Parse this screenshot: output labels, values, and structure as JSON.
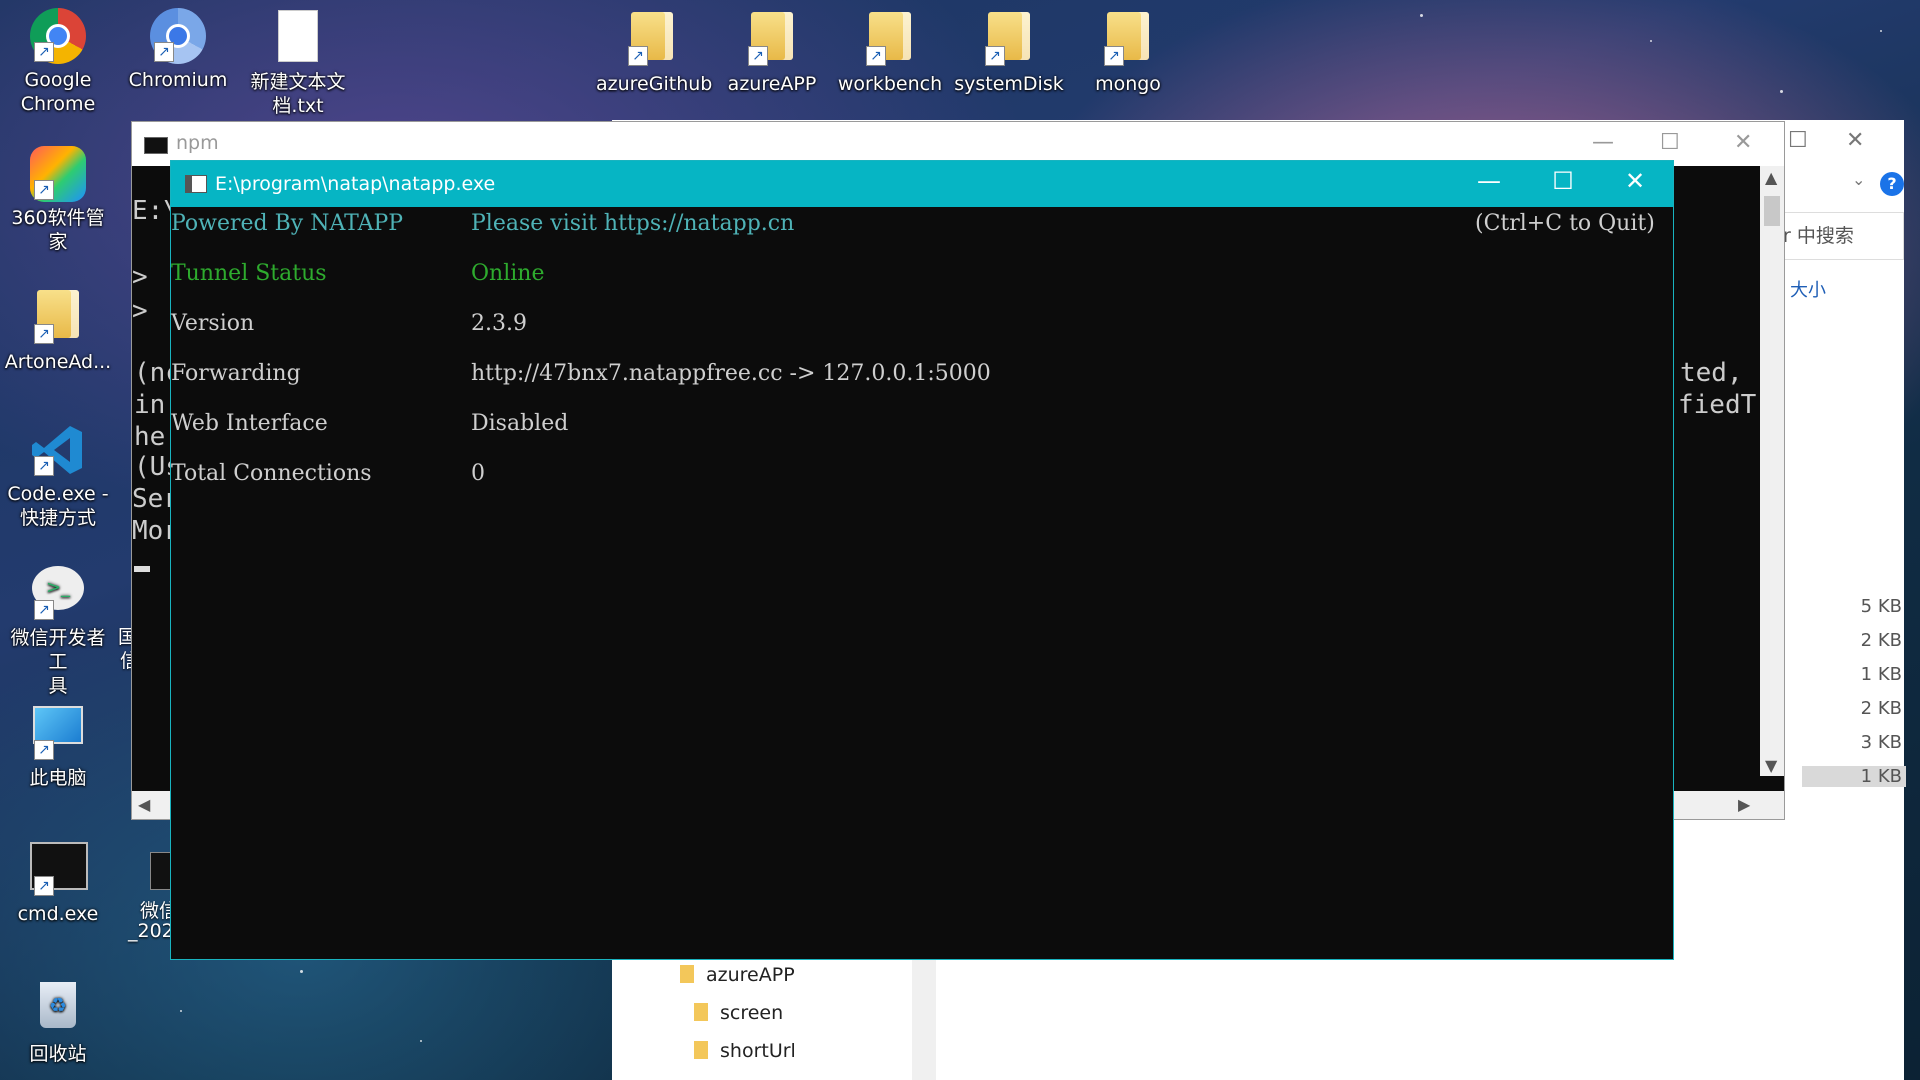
{
  "desktop": {
    "icons_left": [
      {
        "label": "Google\nChrome",
        "icon": "chrome-icon"
      },
      {
        "label": "360软件管家",
        "icon": "360-software-manager-icon"
      },
      {
        "label": "ArtoneAd...",
        "icon": "folder-icon"
      },
      {
        "label": "Code.exe -\n快捷方式",
        "icon": "vscode-icon"
      },
      {
        "label": "微信开发者工\n具",
        "icon": "wechat-devtools-icon"
      },
      {
        "label": "此电脑",
        "icon": "this-pc-icon"
      },
      {
        "label": "cmd.exe",
        "icon": "cmd-icon"
      },
      {
        "label": "回收站",
        "icon": "recycle-bin-icon"
      }
    ],
    "icons_top": [
      {
        "label": "Chromium",
        "icon": "chromium-icon"
      },
      {
        "label": "新建文本文\n档.txt",
        "icon": "text-file-icon"
      },
      {
        "label": "azureGithub",
        "icon": "folder-icon"
      },
      {
        "label": "azureAPP",
        "icon": "folder-icon"
      },
      {
        "label": "workbench",
        "icon": "folder-icon"
      },
      {
        "label": "systemDisk",
        "icon": "folder-icon"
      },
      {
        "label": "mongo",
        "icon": "folder-icon"
      }
    ],
    "partial_labels": {
      "col2_a": "国",
      "col2_b": "信",
      "wechat_partial_1": "微信",
      "wechat_partial_2": "_202"
    }
  },
  "explorer": {
    "search_placeholder": "r 中搜索",
    "size_header": "大小",
    "sizes": [
      "5 KB",
      "2 KB",
      "1 KB",
      "2 KB",
      "3 KB",
      "1 KB"
    ],
    "tree": [
      "azureAPP",
      "screen",
      "shortUrl"
    ],
    "help": "?"
  },
  "npm_window": {
    "title": "npm",
    "lines_left": [
      "E:\\",
      ">",
      ">",
      "(nc",
      "in",
      "he",
      "(Us",
      "Ser",
      "Mor"
    ],
    "lines_right": [
      "ted,",
      "fiedT"
    ]
  },
  "natapp_window": {
    "title": "E:\\program\\natap\\natapp.exe",
    "header": {
      "left": "Powered By NATAPP",
      "middle": "Please visit https://natapp.cn",
      "right": "(Ctrl+C to Quit)"
    },
    "rows": [
      {
        "label": "Tunnel Status",
        "value": "Online"
      },
      {
        "label": "Version",
        "value": "2.3.9"
      },
      {
        "label": "Forwarding",
        "value": "http://47bnx7.natappfree.cc -> 127.0.0.1:5000"
      },
      {
        "label": "Web Interface",
        "value": "Disabled"
      },
      {
        "label": "Total Connections",
        "value": "0"
      }
    ],
    "colors": {
      "titlebar": "#06b5c4",
      "online": "#2eab2e",
      "header": "#4fb3b7"
    }
  }
}
